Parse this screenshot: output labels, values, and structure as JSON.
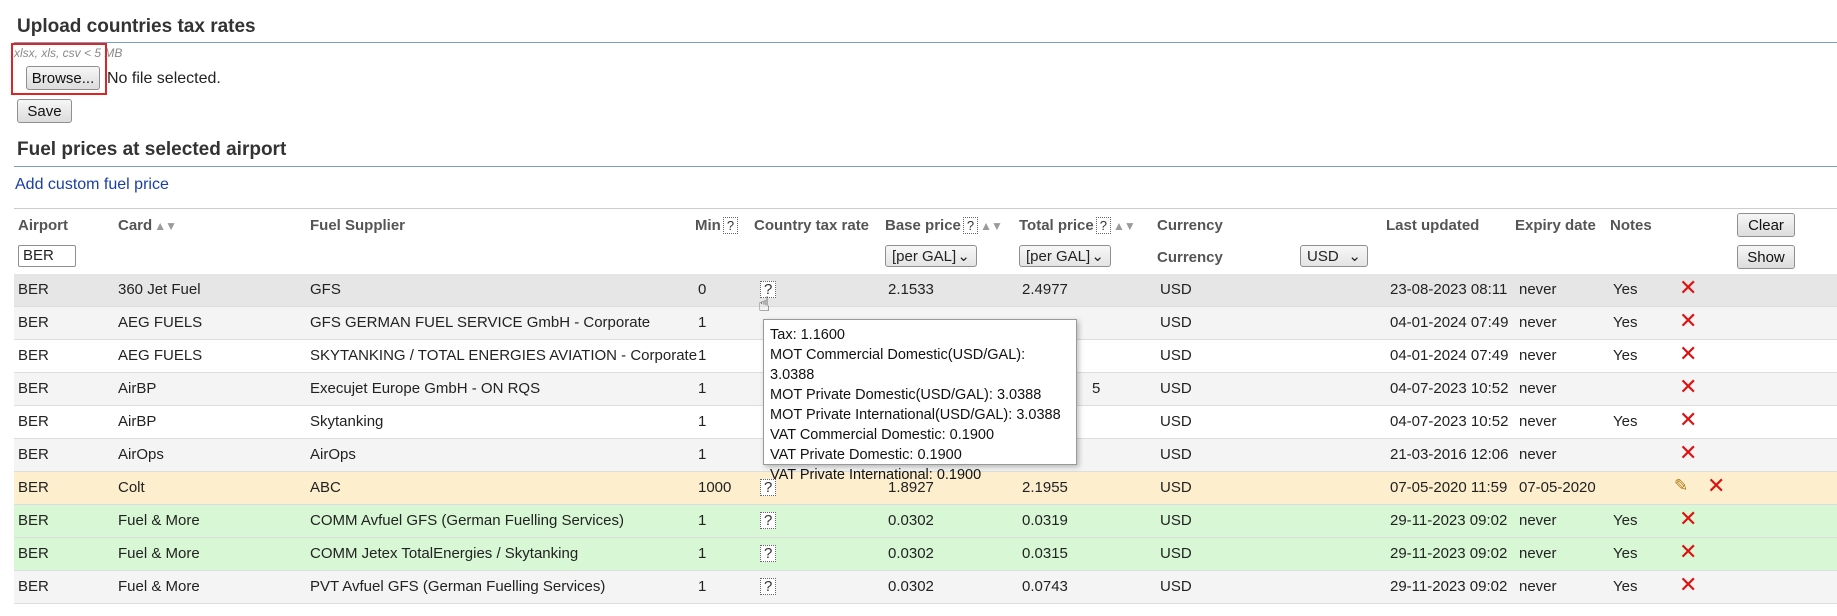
{
  "upload": {
    "title": "Upload countries tax rates",
    "hint": "xlsx, xls, csv < 5 MB",
    "browse_label": "Browse...",
    "no_file": "No file selected.",
    "save_label": "Save"
  },
  "fuel": {
    "title": "Fuel prices at selected airport",
    "add_link": "Add custom fuel price"
  },
  "table": {
    "headers": {
      "airport": "Airport",
      "card": "Card",
      "supplier": "Fuel Supplier",
      "min": "Min",
      "tax": "Country tax rate",
      "base": "Base price",
      "total": "Total price",
      "currency": "Currency",
      "last_updated": "Last updated",
      "expiry": "Expiry date",
      "notes": "Notes",
      "clear": "Clear",
      "show": "Show",
      "q": "?",
      "sort": "▲▼"
    },
    "filters": {
      "airport_value": "BER",
      "base_unit": "[per GAL]",
      "total_unit": "[per GAL]",
      "currency_label": "Currency",
      "currency_value": "USD"
    },
    "rows": [
      {
        "airport": "BER",
        "card": "360 Jet Fuel",
        "supplier": "GFS",
        "min": "0",
        "tax": "?",
        "base": "2.1533",
        "total": "2.4977",
        "currency": "USD",
        "updated": "23-08-2023 08:11",
        "expiry": "never",
        "notes": "Yes"
      },
      {
        "airport": "BER",
        "card": "AEG FUELS",
        "supplier": "GFS GERMAN FUEL SERVICE GmbH - Corporate",
        "min": "1",
        "tax": "",
        "base": "",
        "total": "",
        "currency": "USD",
        "updated": "04-01-2024 07:49",
        "expiry": "never",
        "notes": "Yes"
      },
      {
        "airport": "BER",
        "card": "AEG FUELS",
        "supplier": "SKYTANKING / TOTAL ENERGIES AVIATION - Corporate",
        "min": "1",
        "tax": "",
        "base": "",
        "total": "",
        "currency": "USD",
        "updated": "04-01-2024 07:49",
        "expiry": "never",
        "notes": "Yes"
      },
      {
        "airport": "BER",
        "card": "AirBP",
        "supplier": "Execujet Europe GmbH - ON RQS",
        "min": "1",
        "tax": "",
        "base": "",
        "total": "5",
        "currency": "USD",
        "updated": "04-07-2023 10:52",
        "expiry": "never",
        "notes": ""
      },
      {
        "airport": "BER",
        "card": "AirBP",
        "supplier": "Skytanking",
        "min": "1",
        "tax": "",
        "base": "",
        "total": "",
        "currency": "USD",
        "updated": "04-07-2023 10:52",
        "expiry": "never",
        "notes": "Yes"
      },
      {
        "airport": "BER",
        "card": "AirOps",
        "supplier": "AirOps",
        "min": "1",
        "tax": "",
        "base": "",
        "total": "",
        "currency": "USD",
        "updated": "21-03-2016 12:06",
        "expiry": "never",
        "notes": ""
      },
      {
        "airport": "BER",
        "card": "Colt",
        "supplier": "ABC",
        "min": "1000",
        "tax": "?",
        "base": "1.8927",
        "total": "2.1955",
        "currency": "USD",
        "updated": "07-05-2020 11:59",
        "expiry": "07-05-2020",
        "notes": ""
      },
      {
        "airport": "BER",
        "card": "Fuel & More",
        "supplier": "COMM Avfuel GFS (German Fuelling Services)",
        "min": "1",
        "tax": "?",
        "base": "0.0302",
        "total": "0.0319",
        "currency": "USD",
        "updated": "29-11-2023 09:02",
        "expiry": "never",
        "notes": "Yes"
      },
      {
        "airport": "BER",
        "card": "Fuel & More",
        "supplier": "COMM Jetex TotalEnergies / Skytanking",
        "min": "1",
        "tax": "?",
        "base": "0.0302",
        "total": "0.0315",
        "currency": "USD",
        "updated": "29-11-2023 09:02",
        "expiry": "never",
        "notes": "Yes"
      },
      {
        "airport": "BER",
        "card": "Fuel & More",
        "supplier": "PVT Avfuel GFS (German Fuelling Services)",
        "min": "1",
        "tax": "?",
        "base": "0.0302",
        "total": "0.0743",
        "currency": "USD",
        "updated": "29-11-2023 09:02",
        "expiry": "never",
        "notes": "Yes"
      }
    ]
  },
  "tooltip": {
    "lines": [
      "Tax: 1.1600",
      "MOT Commercial Domestic(USD/GAL): 3.0388",
      "MOT Private Domestic(USD/GAL): 3.0388",
      "MOT Private International(USD/GAL): 3.0388",
      "VAT Commercial Domestic: 0.1900",
      "VAT Private Domestic: 0.1900",
      "VAT Private International: 0.1900"
    ]
  },
  "icons": {
    "delete": "✕",
    "edit": "✎",
    "chevron": "⌄",
    "cursor": "☝"
  }
}
